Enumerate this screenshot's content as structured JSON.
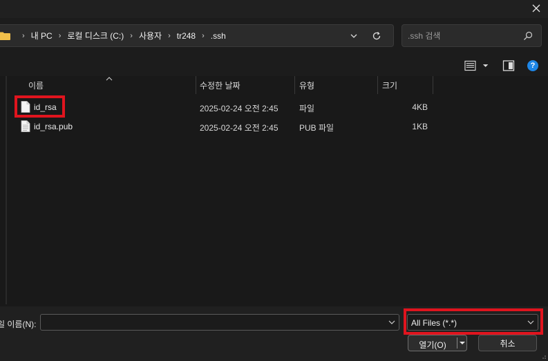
{
  "breadcrumbs": [
    "내 PC",
    "로컬 디스크 (C:)",
    "사용자",
    "tr248",
    ".ssh"
  ],
  "search": {
    "placeholder": ".ssh 검색"
  },
  "columns": [
    {
      "label": "이름"
    },
    {
      "label": "수정한 날짜"
    },
    {
      "label": "유형"
    },
    {
      "label": "크기"
    }
  ],
  "files": [
    {
      "name": "id_rsa",
      "modified": "2025-02-24 오전 2:45",
      "type": "파일",
      "size": "4KB"
    },
    {
      "name": "id_rsa.pub",
      "modified": "2025-02-24 오전 2:45",
      "type": "PUB 파일",
      "size": "1KB"
    }
  ],
  "bottom": {
    "filename_label": "일 이름(N):",
    "filename_value": "",
    "filetype_value": "All Files (*.*)",
    "open_label": "열기(O)",
    "cancel_label": "취소"
  },
  "colors": {
    "highlight": "#e0141e",
    "help_accent": "#1e86e6",
    "folder": "#f2c04a"
  }
}
